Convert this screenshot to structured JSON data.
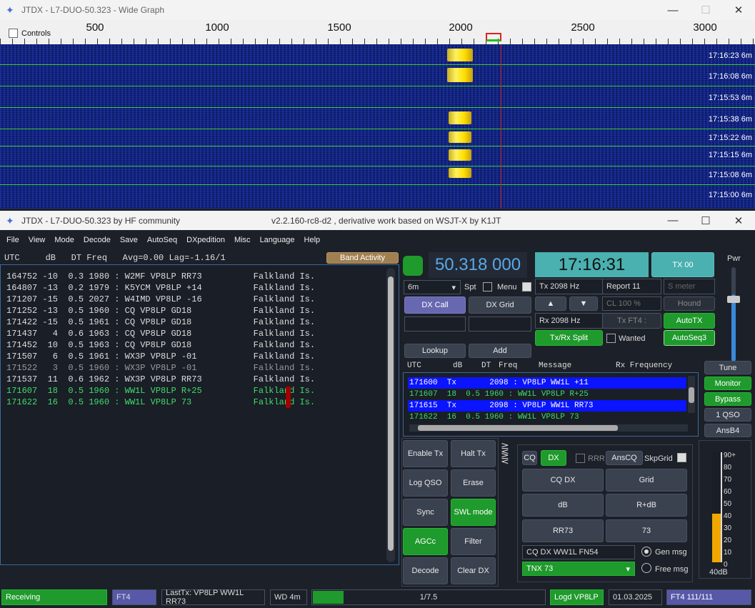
{
  "wide_graph": {
    "title": "JTDX - L7-DUO-50.323 - Wide Graph",
    "controls_label": "Controls",
    "scale_labels": [
      "500",
      "1000",
      "1500",
      "2000",
      "2500",
      "3000"
    ],
    "band": "6m",
    "rows": [
      {
        "time": "17:16:23"
      },
      {
        "time": "17:16:08"
      },
      {
        "time": "17:15:53"
      },
      {
        "time": "17:15:38"
      },
      {
        "time": "17:15:22"
      },
      {
        "time": "17:15:15"
      },
      {
        "time": "17:15:08"
      },
      {
        "time": "17:15:00"
      }
    ]
  },
  "main": {
    "title_left": "JTDX - L7-DUO-50.323  by HF community",
    "title_center": "v2.2.160-rc8-d2 , derivative work based on WSJT-X by K1JT",
    "menu": [
      "File",
      "View",
      "Mode",
      "Decode",
      "Save",
      "AutoSeq",
      "DXpedition",
      "Misc",
      "Language",
      "Help"
    ],
    "band_header": "UTC     dB   DT Freq   Avg=0.00 Lag=-1.16/1",
    "band_activity_label": "Band Activity",
    "band_rows": [
      {
        "text": "164752 -10  0.3 1980 : W2MF VP8LP RR73          Falkland Is.",
        "color": "#e8e8e8"
      },
      {
        "text": "164807 -13  0.2 1979 : K5YCM VP8LP +14          Falkland Is.",
        "color": "#e8e8e8"
      },
      {
        "text": "171207 -15  0.5 2027 : W4IMD VP8LP -16          Falkland Is.",
        "color": "#e8e8e8"
      },
      {
        "text": "171252 -13  0.5 1960 : CQ VP8LP GD18            Falkland Is.",
        "color": "#e8e8e8"
      },
      {
        "text": "171422 -15  0.5 1961 : CQ VP8LP GD18            Falkland Is.",
        "color": "#e8e8e8"
      },
      {
        "text": "171437   4  0.6 1963 : CQ VP8LP GD18            Falkland Is.",
        "color": "#e8e8e8"
      },
      {
        "text": "171452  10  0.5 1963 : CQ VP8LP GD18            Falkland Is.",
        "color": "#e8e8e8"
      },
      {
        "text": "171507   6  0.5 1961 : WX3P VP8LP -01           Falkland Is.",
        "color": "#e8e8e8"
      },
      {
        "text": "171522   3  0.5 1960 : WX3P VP8LP -01           Falkland Is.",
        "color": "#9a9a9a"
      },
      {
        "text": "171537  11  0.6 1962 : WX3P VP8LP RR73          Falkland Is.",
        "color": "#e8e8e8"
      },
      {
        "text": "171607  18  0.5 1960 : WW1L VP8LP R+25          Falkland Is.",
        "color": "#3fdc6a"
      },
      {
        "text": "171622  16  0.5 1960 : WW1L VP8LP 73            Falkland Is.",
        "color": "#3fdc6a"
      }
    ],
    "frequency": "50.318 000",
    "clock": "17:16:31",
    "tx00": "TX 00",
    "band_select": "6m",
    "spt": "Spt",
    "menu_label": "Menu",
    "tx_hz": "Tx  2098  Hz",
    "rx_hz": "Rx  2098  Hz",
    "report": "Report 11",
    "s_meter": "S meter",
    "cl": "CL  100 %",
    "hound": "Hound",
    "tx_ft4": "Tx FT4 :",
    "autotx": "AutoTX",
    "autoseq3": "AutoSeq3",
    "wanted": "Wanted",
    "txrx_split": "Tx/Rx Split",
    "dx_call": "DX Call",
    "dx_grid": "DX Grid",
    "lookup": "Lookup",
    "add": "Add",
    "pwr": "Pwr",
    "rx_header": {
      "utc": "UTC",
      "db": "dB",
      "dt": "DT",
      "freq": "Freq",
      "message": "Message",
      "rxfreq": "Rx Frequency"
    },
    "rx_rows": [
      {
        "text": "171600  Tx       2098 : VP8LP WW1L +11",
        "bg": "#0a14ff",
        "color": "#fff"
      },
      {
        "text": "171607  18  0.5 1960 : WW1L VP8LP R+25",
        "bg": "",
        "color": "#3fdc6a"
      },
      {
        "text": "171615  Tx       2098 : VP8LP WW1L RR73",
        "bg": "#0a14ff",
        "color": "#fff"
      },
      {
        "text": "171622  16  0.5 1960 : WW1L VP8LP 73",
        "bg": "",
        "color": "#3fdc6a"
      }
    ],
    "right_buttons": [
      "Tune",
      "Monitor",
      "Bypass",
      "1 QSO",
      "AnsB4"
    ],
    "left_buttons": [
      "Enable Tx",
      "Halt Tx",
      "Log QSO",
      "Erase",
      "Sync",
      "SWL mode",
      "AGCc",
      "Filter",
      "Decode",
      "Clear DX"
    ],
    "seq": {
      "cq": "CQ",
      "dx": "DX",
      "rrr": "RRR",
      "anscq": "AnsCQ",
      "skpgrid": "SkpGrid"
    },
    "msg_buttons": [
      "CQ DX",
      "Grid",
      "dB",
      "R+dB",
      "RR73",
      "73"
    ],
    "gen_msg_text": "CQ DX WW1L FN54",
    "free_msg_text": "TNX 73",
    "gen_msg": "Gen msg",
    "free_msg": "Free msg",
    "meter_labels": [
      "90+",
      "80",
      "70",
      "60",
      "50",
      "40",
      "30",
      "20",
      "10",
      "0"
    ],
    "meter_db": "40dB",
    "meter_level": 40,
    "status": {
      "receiving": "Receiving",
      "mode": "FT4",
      "lasttx": "LastTx: VP8LP WW1L RR73",
      "wd": "WD 4m",
      "progress": "1/7.5",
      "progress_fraction": 0.133,
      "logd": "Logd VP8LP",
      "date": "01.03.2025",
      "ft4count": "FT4  111/111"
    }
  }
}
